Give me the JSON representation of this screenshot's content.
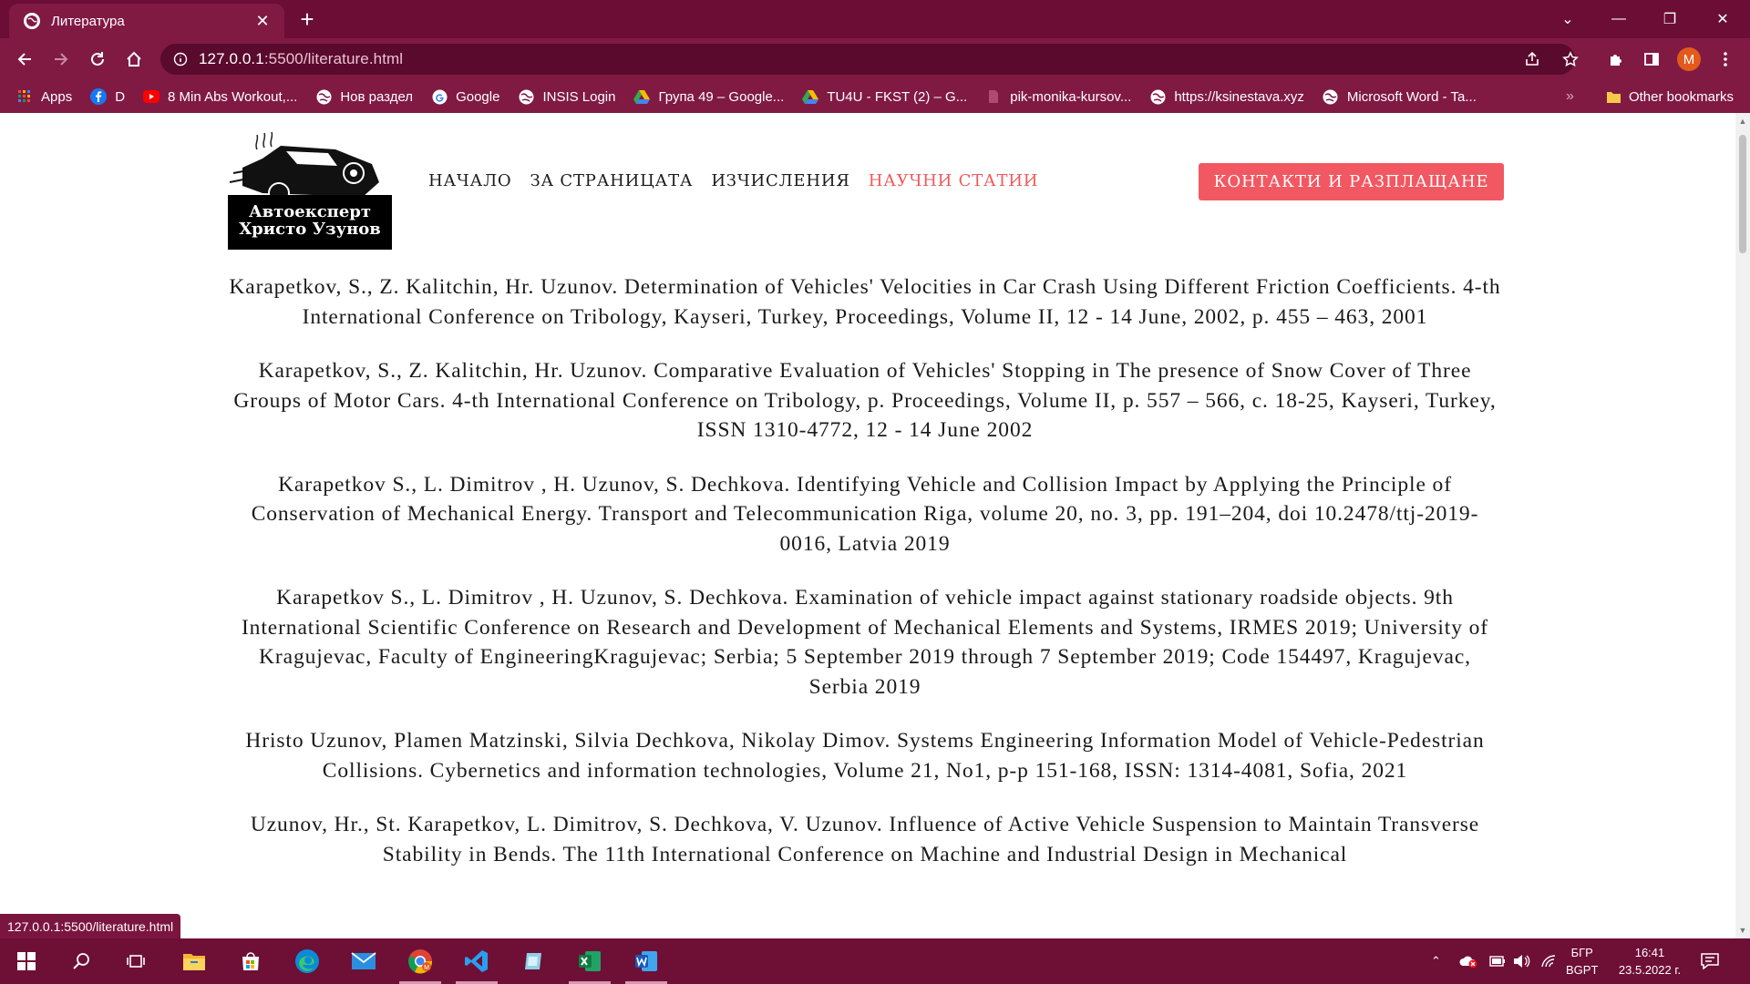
{
  "browser": {
    "tab_title": "Литература",
    "url_host": "127.0.0.1",
    "url_path": ":5500/literature.html",
    "profile_initial": "M",
    "bookmarks": [
      {
        "label": "Apps",
        "icon": "apps-grid-icon"
      },
      {
        "label": "D",
        "icon": "facebook-icon"
      },
      {
        "label": "8 Min Abs Workout,...",
        "icon": "youtube-icon"
      },
      {
        "label": "Нов раздел",
        "icon": "globe-icon"
      },
      {
        "label": "Google",
        "icon": "google-icon"
      },
      {
        "label": "INSIS Login",
        "icon": "globe-icon"
      },
      {
        "label": "Група 49 – Google...",
        "icon": "google-drive-icon"
      },
      {
        "label": "TU4U - FKST (2) – G...",
        "icon": "google-drive-icon"
      },
      {
        "label": "pik-monika-kursov...",
        "icon": "file-icon"
      },
      {
        "label": "https://ksinestava.xyz",
        "icon": "globe-icon"
      },
      {
        "label": "Microsoft Word - Ta...",
        "icon": "globe-icon"
      }
    ],
    "other_bookmarks": "Other bookmarks",
    "status_url": "127.0.0.1:5500/literature.html"
  },
  "site": {
    "logo_line1": "Автоексперт",
    "logo_line2": "Христо Узунов",
    "nav": [
      {
        "label": "НАЧАЛО",
        "active": false
      },
      {
        "label": "ЗА СТРАНИЦАТА",
        "active": false
      },
      {
        "label": "ИЗЧИСЛЕНИЯ",
        "active": false
      },
      {
        "label": "НАУЧНИ СТАТИИ",
        "active": true
      }
    ],
    "cta": "КОНТАКТИ И РАЗПЛАЩАНЕ",
    "accent_color": "#f25862"
  },
  "references": [
    "Karapetkov, S., Z. Kalitchin, Hr. Uzunov. Determination of Vehicles' Velocities in Car Crash Using Different Friction Coefficients. 4-th International Conference on Tribology, Kayseri, Turkey, Proceedings, Volume II, 12 - 14 June, 2002, p. 455 – 463, 2001",
    "Karapetkov, S., Z. Kalitchin, Hr. Uzunov. Comparative Evaluation of Vehicles' Stopping in The presence of Snow Cover of Three Groups of Motor Cars. 4-th International Conference on Tribology, p. Proceedings, Volume II, p. 557 – 566, c. 18-25, Kayseri, Turkey, ISSN 1310-4772, 12 - 14 June 2002",
    "Karapetkov S., L. Dimitrov , H. Uzunov, S. Dechkova. Identifying Vehicle and Collision Impact by Applying the Principle of Conservation of Mechanical Energy. Transport and Telecommunication Riga, volume 20, no. 3, pp. 191–204, doi 10.2478/ttj-2019-0016, Latvia 2019",
    "Karapetkov S., L. Dimitrov , H. Uzunov, S. Dechkova. Examination of vehicle impact against stationary roadside objects. 9th International Scientific Conference on Research and Development of Mechanical Elements and Systems, IRMES 2019; University of Kragujevac, Faculty of EngineeringKragujevac; Serbia; 5 September 2019 through 7 September 2019; Code 154497, Kragujevac, Serbia 2019",
    "Hristo Uzunov, Plamen Matzinski, Silvia Dechkova, Nikolay Dimov. Systems Engineering Information Model of Vehicle-Pedestrian Collisions. Cybernetics and information technologies, Volume 21, No1, p-p 151-168, ISSN: 1314-4081, Sofia, 2021",
    "Uzunov, Hr., St. Karapetkov, L. Dimitrov, S. Dechkova, V. Uzunov. Influence of Active Vehicle Suspension to Maintain Transverse Stability in Bends. The 11th International Conference on Machine and Industrial Design in Mechanical"
  ],
  "taskbar": {
    "lang_line1": "БГР",
    "lang_line2": "BGPT",
    "time": "16:41",
    "date": "23.5.2022 г."
  }
}
